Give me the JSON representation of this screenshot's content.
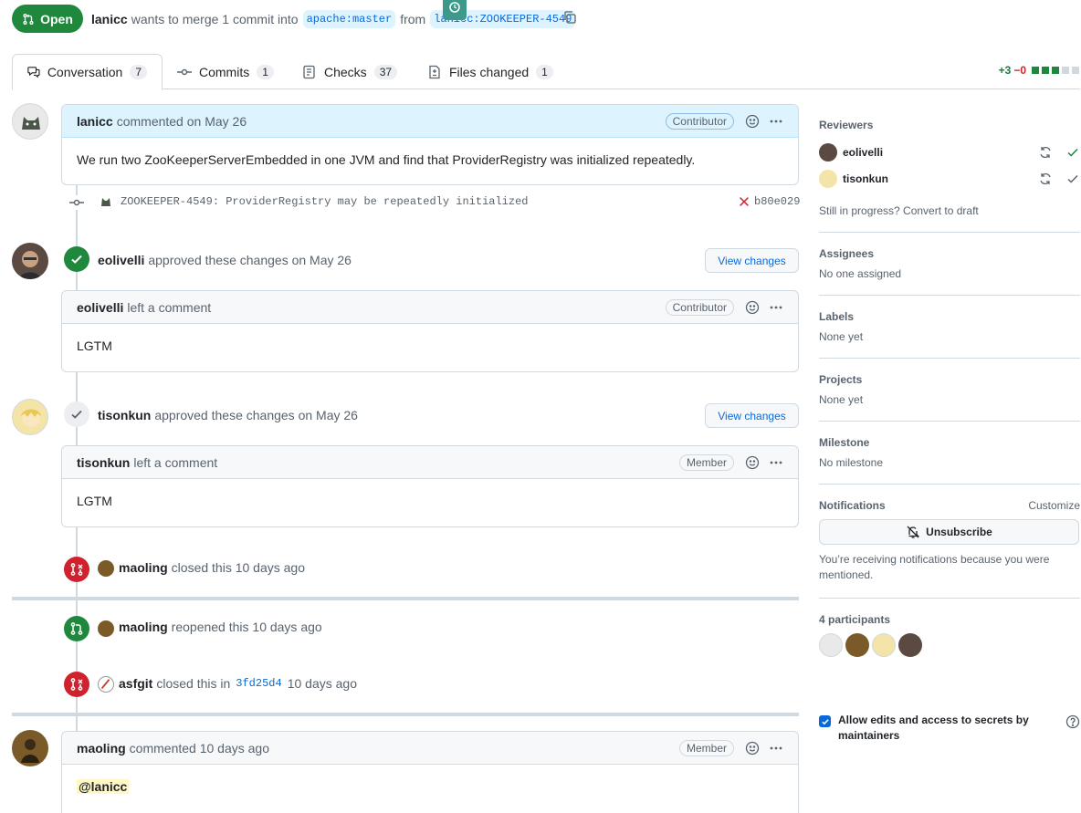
{
  "header": {
    "state_label": "Open",
    "author": "lanicc",
    "merge_text": "wants to merge 1 commit into",
    "base_branch": "apache:master",
    "from_text": "from",
    "head_branch": "lanicc:ZOOKEEPER-4549"
  },
  "tabs": [
    {
      "label": "Conversation",
      "count": "7"
    },
    {
      "label": "Commits",
      "count": "1"
    },
    {
      "label": "Checks",
      "count": "37"
    },
    {
      "label": "Files changed",
      "count": "1"
    }
  ],
  "diffstat": {
    "plus": "+3",
    "minus": "−0"
  },
  "comment1": {
    "author": "lanicc",
    "action": "commented on May 26",
    "role": "Contributor",
    "body": "We run two ZooKeeperServerEmbedded in one JVM and find that ProviderRegistry was initialized repeatedly."
  },
  "commit": {
    "message": "ZOOKEEPER-4549: ProviderRegistry may be repeatedly initialized",
    "sha": "b80e029"
  },
  "review1": {
    "author": "eolivelli",
    "action": "approved these changes on May 26",
    "button": "View changes",
    "comment_author": "eolivelli",
    "comment_action": "left a comment",
    "role": "Contributor",
    "body": "LGTM"
  },
  "review2": {
    "author": "tisonkun",
    "action": "approved these changes on May 26",
    "button": "View changes",
    "comment_author": "tisonkun",
    "comment_action": "left a comment",
    "role": "Member",
    "body": "LGTM"
  },
  "event1": {
    "author": "maoling",
    "action": "closed this 10 days ago"
  },
  "event2": {
    "author": "maoling",
    "action": "reopened this 10 days ago"
  },
  "event3": {
    "author": "asfgit",
    "action": "closed this in",
    "sha": "3fd25d4",
    "time": "10 days ago"
  },
  "comment2": {
    "author": "maoling",
    "action": "commented 10 days ago",
    "role": "Member",
    "mention": "@lanicc"
  },
  "sidebar": {
    "reviewers_title": "Reviewers",
    "reviewers": [
      {
        "name": "eolivelli"
      },
      {
        "name": "tisonkun"
      }
    ],
    "draft_text": "Still in progress? Convert to draft",
    "assignees_title": "Assignees",
    "assignees_value": "No one assigned",
    "labels_title": "Labels",
    "labels_value": "None yet",
    "projects_title": "Projects",
    "projects_value": "None yet",
    "milestone_title": "Milestone",
    "milestone_value": "No milestone",
    "notifications_title": "Notifications",
    "customize": "Customize",
    "unsubscribe": "Unsubscribe",
    "notify_reason": "You’re receiving notifications because you were mentioned.",
    "participants_title": "4 participants",
    "allow_edits": "Allow edits and access to secrets by maintainers"
  },
  "colors": {
    "green": "#1f883d",
    "red": "#cf222e",
    "blue": "#0969da"
  }
}
